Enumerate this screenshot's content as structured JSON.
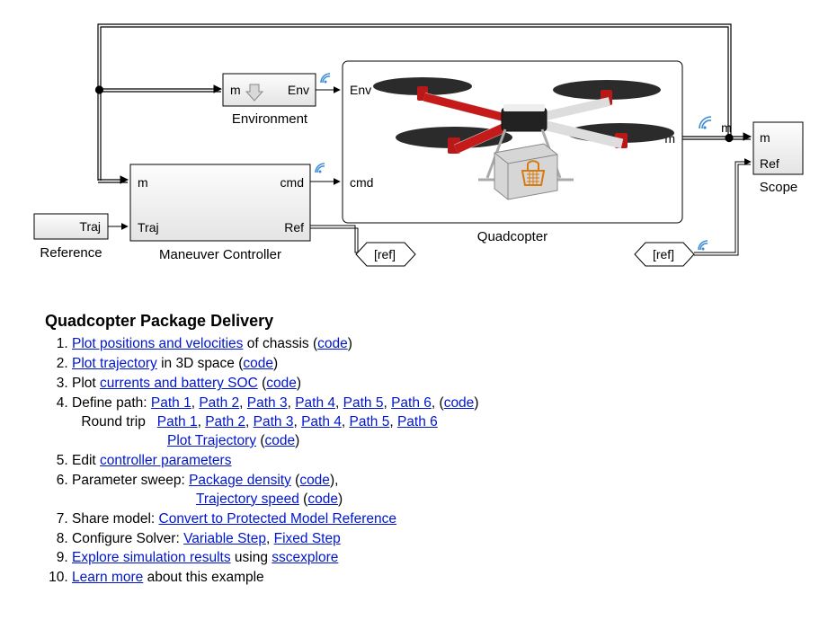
{
  "diagram": {
    "environment": {
      "label": "Environment",
      "port_m": "m",
      "port_env": "Env"
    },
    "maneuver": {
      "label": "Maneuver Controller",
      "port_m": "m",
      "port_cmd": "cmd",
      "port_traj": "Traj",
      "port_ref": "Ref"
    },
    "reference": {
      "label": "Reference",
      "port_traj": "Traj"
    },
    "quadcopter": {
      "label": "Quadcopter",
      "port_env": "Env",
      "port_cmd": "cmd",
      "port_m": "m"
    },
    "scope": {
      "label": "Scope",
      "port_m": "m",
      "port_ref": "Ref"
    },
    "goto_in": "[ref]",
    "goto_out": "[ref]"
  },
  "heading": "Quadcopter Package Delivery",
  "items": {
    "i1": {
      "link": "Plot positions and velocities",
      "rest": " of chassis (",
      "code": "code",
      "close": ")"
    },
    "i2": {
      "link": "Plot trajectory",
      "rest": " in 3D space (",
      "code": "code",
      "close": ")"
    },
    "i3": {
      "pre": "Plot ",
      "link": "currents and battery SOC",
      "rest": " (",
      "code": "code",
      "close": ")"
    },
    "i4": {
      "pre": "Define path: ",
      "p1": "Path 1",
      "p2": "Path 2",
      "p3": "Path 3",
      "p4": "Path 4",
      "p5": "Path 5",
      "p6": "Path 6",
      "code": "code",
      "round_label": "Round trip",
      "rp1": "Path 1",
      "rp2": "Path 2",
      "rp3": "Path 3",
      "rp4": "Path 4",
      "rp5": "Path 5",
      "rp6": "Path 6",
      "plot_traj": "Plot Trajectory",
      "plot_code": "code"
    },
    "i5": {
      "pre": "Edit ",
      "link": "controller parameters"
    },
    "i6": {
      "pre": "Parameter sweep: ",
      "pd": "Package density",
      "code1": "code",
      "ts": "Trajectory speed",
      "code2": "code"
    },
    "i7": {
      "pre": "Share model: ",
      "link": "Convert to Protected Model Reference"
    },
    "i8": {
      "pre": "Configure Solver: ",
      "vs": "Variable Step",
      "fs": "Fixed Step"
    },
    "i9": {
      "link": "Explore simulation results",
      "mid": " using ",
      "ssc": "sscexplore"
    },
    "i10": {
      "link": "Learn more",
      "rest": " about this example"
    }
  }
}
